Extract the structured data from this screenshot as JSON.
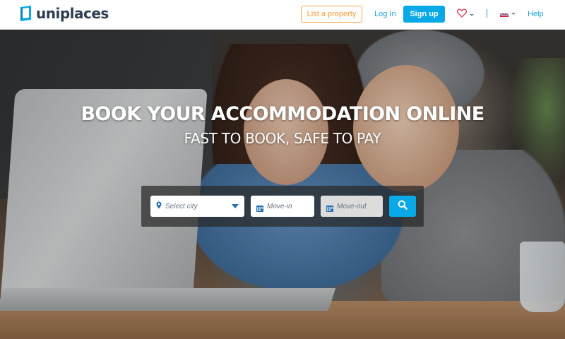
{
  "header": {
    "logo_text": "uniplaces",
    "list_property_label": "List a property",
    "login_label": "Log In",
    "signup_label": "Sign up",
    "help_label": "Help"
  },
  "hero": {
    "title": "BOOK YOUR ACCOMMODATION ONLINE",
    "subtitle": "FAST TO BOOK, SAFE TO PAY"
  },
  "search": {
    "city_placeholder": "Select city",
    "movein_placeholder": "Move-in",
    "moveout_placeholder": "Move-out"
  },
  "colors": {
    "brand": "#08a9e6",
    "accent_orange": "#f39a33",
    "logo_dark": "#2d3e50"
  },
  "icons": [
    "logo-mark-icon",
    "heart-icon",
    "uk-flag-icon",
    "location-pin-icon",
    "calendar-icon",
    "search-icon"
  ]
}
